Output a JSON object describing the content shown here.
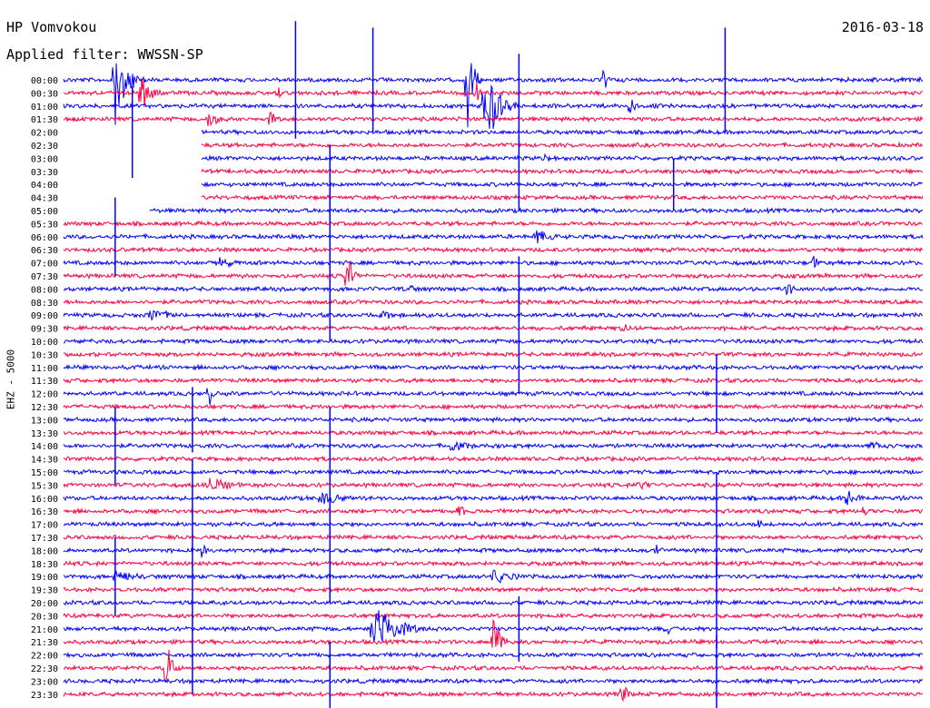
{
  "header": {
    "station": "HP Vomvokou",
    "date": "2016-03-18",
    "filter": "Applied filter: WWSSN-SP"
  },
  "channel_label": "EHZ - 5000",
  "chart_data": {
    "type": "line",
    "description": "helicorder",
    "row_labels": [
      "00:00",
      "00:30",
      "01:00",
      "01:30",
      "02:00",
      "02:30",
      "03:00",
      "03:30",
      "04:00",
      "04:30",
      "05:00",
      "05:30",
      "06:00",
      "06:30",
      "07:00",
      "07:30",
      "08:00",
      "08:30",
      "09:00",
      "09:30",
      "10:00",
      "10:30",
      "11:00",
      "11:30",
      "12:00",
      "12:30",
      "13:00",
      "13:30",
      "14:00",
      "14:30",
      "15:00",
      "15:30",
      "16:00",
      "16:30",
      "17:00",
      "17:30",
      "18:00",
      "18:30",
      "19:00",
      "19:30",
      "20:00",
      "20:30",
      "21:00",
      "21:30",
      "22:00",
      "22:30",
      "23:00",
      "23:30"
    ],
    "colors": {
      "blue": "#0000ff",
      "red": "#ff0040"
    },
    "color_cycle": [
      "blue",
      "red"
    ],
    "events": [
      {
        "row": 0,
        "t": 0.06,
        "amp": 5.0,
        "dur": 0.04
      },
      {
        "row": 0,
        "t": 0.47,
        "amp": 5.5,
        "dur": 0.02
      },
      {
        "row": 0,
        "t": 0.63,
        "amp": 2.2,
        "dur": 0.01
      },
      {
        "row": 1,
        "t": 0.09,
        "amp": 2.5,
        "dur": 0.03
      },
      {
        "row": 1,
        "t": 0.25,
        "amp": 1.0,
        "dur": 0.01
      },
      {
        "row": 1,
        "t": 0.48,
        "amp": 2.0,
        "dur": 0.01
      },
      {
        "row": 2,
        "t": 0.49,
        "amp": 6.0,
        "dur": 0.04
      },
      {
        "row": 2,
        "t": 0.66,
        "amp": 1.8,
        "dur": 0.01
      },
      {
        "row": 3,
        "t": 0.17,
        "amp": 2.0,
        "dur": 0.02
      },
      {
        "row": 3,
        "t": 0.24,
        "amp": 1.3,
        "dur": 0.02
      },
      {
        "row": 5,
        "t": 0.14,
        "amp": 1.0,
        "dur": 0.02
      },
      {
        "row": 6,
        "t": 0.56,
        "amp": 0.8,
        "dur": 0.02
      },
      {
        "row": 12,
        "t": 0.55,
        "amp": 1.0,
        "dur": 0.05
      },
      {
        "row": 14,
        "t": 0.18,
        "amp": 0.8,
        "dur": 0.06
      },
      {
        "row": 14,
        "t": 0.87,
        "amp": 1.0,
        "dur": 0.03
      },
      {
        "row": 15,
        "t": 0.33,
        "amp": 3.0,
        "dur": 0.02
      },
      {
        "row": 16,
        "t": 0.4,
        "amp": 0.8,
        "dur": 0.03
      },
      {
        "row": 16,
        "t": 0.84,
        "amp": 0.8,
        "dur": 0.06
      },
      {
        "row": 18,
        "t": 0.1,
        "amp": 0.9,
        "dur": 0.08
      },
      {
        "row": 18,
        "t": 0.37,
        "amp": 0.8,
        "dur": 0.05
      },
      {
        "row": 19,
        "t": 0.65,
        "amp": 0.6,
        "dur": 0.05
      },
      {
        "row": 24,
        "t": 0.17,
        "amp": 2.0,
        "dur": 0.01
      },
      {
        "row": 28,
        "t": 0.45,
        "amp": 0.8,
        "dur": 0.07
      },
      {
        "row": 28,
        "t": 0.94,
        "amp": 0.8,
        "dur": 0.03
      },
      {
        "row": 31,
        "t": 0.17,
        "amp": 1.0,
        "dur": 0.08
      },
      {
        "row": 31,
        "t": 0.67,
        "amp": 0.8,
        "dur": 0.04
      },
      {
        "row": 32,
        "t": 0.3,
        "amp": 1.0,
        "dur": 0.07
      },
      {
        "row": 32,
        "t": 0.91,
        "amp": 1.0,
        "dur": 0.06
      },
      {
        "row": 33,
        "t": 0.46,
        "amp": 1.2,
        "dur": 0.02
      },
      {
        "row": 33,
        "t": 0.93,
        "amp": 0.8,
        "dur": 0.02
      },
      {
        "row": 34,
        "t": 0.81,
        "amp": 1.5,
        "dur": 0.01
      },
      {
        "row": 36,
        "t": 0.16,
        "amp": 1.2,
        "dur": 0.02
      },
      {
        "row": 36,
        "t": 0.69,
        "amp": 0.7,
        "dur": 0.02
      },
      {
        "row": 38,
        "t": 0.06,
        "amp": 1.0,
        "dur": 0.07
      },
      {
        "row": 38,
        "t": 0.5,
        "amp": 1.0,
        "dur": 0.07
      },
      {
        "row": 42,
        "t": 0.36,
        "amp": 3.0,
        "dur": 0.08
      },
      {
        "row": 42,
        "t": 0.7,
        "amp": 1.0,
        "dur": 0.02
      },
      {
        "row": 43,
        "t": 0.5,
        "amp": 2.5,
        "dur": 0.03
      },
      {
        "row": 45,
        "t": 0.12,
        "amp": 3.0,
        "dur": 0.02
      },
      {
        "row": 47,
        "t": 0.65,
        "amp": 1.5,
        "dur": 0.02
      }
    ],
    "spikes": [
      {
        "row": 0,
        "t": 0.27,
        "amp": 4.5
      },
      {
        "row": 0,
        "t": 0.36,
        "amp": 4.0
      },
      {
        "row": 0,
        "t": 0.77,
        "amp": 4.0
      },
      {
        "row": 4,
        "t": 0.53,
        "amp": 6.0
      },
      {
        "row": 4,
        "t": 0.08,
        "amp": 3.5
      },
      {
        "row": 8,
        "t": 0.31,
        "amp": 3.0
      },
      {
        "row": 8,
        "t": 0.71,
        "amp": 2.0
      },
      {
        "row": 12,
        "t": 0.06,
        "amp": 3.0
      },
      {
        "row": 14,
        "t": 0.31,
        "amp": 6.0
      },
      {
        "row": 16,
        "t": 0.53,
        "amp": 2.5
      },
      {
        "row": 20,
        "t": 0.53,
        "amp": 4.0
      },
      {
        "row": 24,
        "t": 0.76,
        "amp": 3.0
      },
      {
        "row": 26,
        "t": 0.15,
        "amp": 2.5
      },
      {
        "row": 28,
        "t": 0.06,
        "amp": 3.0
      },
      {
        "row": 30,
        "t": 0.31,
        "amp": 5.0
      },
      {
        "row": 32,
        "t": 0.15,
        "amp": 3.0
      },
      {
        "row": 34,
        "t": 0.76,
        "amp": 4.0
      },
      {
        "row": 36,
        "t": 0.31,
        "amp": 4.0
      },
      {
        "row": 38,
        "t": 0.06,
        "amp": 3.0
      },
      {
        "row": 38,
        "t": 0.15,
        "amp": 3.0
      },
      {
        "row": 40,
        "t": 0.76,
        "amp": 3.5
      },
      {
        "row": 42,
        "t": 0.53,
        "amp": 2.5
      },
      {
        "row": 44,
        "t": 0.15,
        "amp": 3.0
      },
      {
        "row": 46,
        "t": 0.31,
        "amp": 3.0
      },
      {
        "row": 46,
        "t": 0.76,
        "amp": 3.5
      }
    ],
    "gap": {
      "row_start": 4,
      "row_end": 10,
      "t_start": 0.0,
      "t_end": 0.1
    }
  }
}
